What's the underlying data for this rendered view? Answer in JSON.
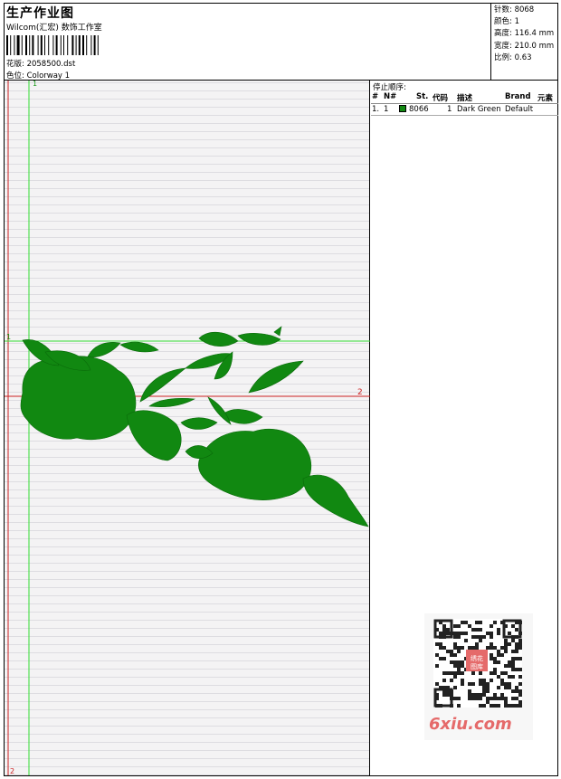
{
  "header": {
    "title": "生产作业图",
    "subtitle": "Wilcom(汇宏) 数饰工作室",
    "design_label": "花版:",
    "design_value": "2058500.dst",
    "color_label": "色位:",
    "color_value": "Colorway 1"
  },
  "specs": [
    {
      "label": "针数:",
      "value": "8068"
    },
    {
      "label": "颜色:",
      "value": "1"
    },
    {
      "label": "高度:",
      "value": "116.4 mm"
    },
    {
      "label": "宽度:",
      "value": "210.0 mm"
    },
    {
      "label": "比例:",
      "value": "0.63"
    }
  ],
  "guides": {
    "vertical_top": "1",
    "vertical_bottom": "2",
    "horizontal_left": "1",
    "horizontal_right": "2"
  },
  "stop_sequence": {
    "label": "停止顺序:",
    "columns": [
      "#",
      "N#",
      "St.",
      "代码",
      "描述",
      "Brand",
      "元素"
    ],
    "rows": [
      {
        "index": "1.",
        "needle": "1",
        "stitches": "8066",
        "code": "1",
        "description": "Dark Green",
        "brand": "Default",
        "color": "#118811"
      }
    ]
  },
  "watermark": {
    "text": "6xiu.com",
    "seal": "绣花图库"
  },
  "colors": {
    "thread": "#118811",
    "guide_green": "#33dd33",
    "guide_red": "#cc2222"
  }
}
